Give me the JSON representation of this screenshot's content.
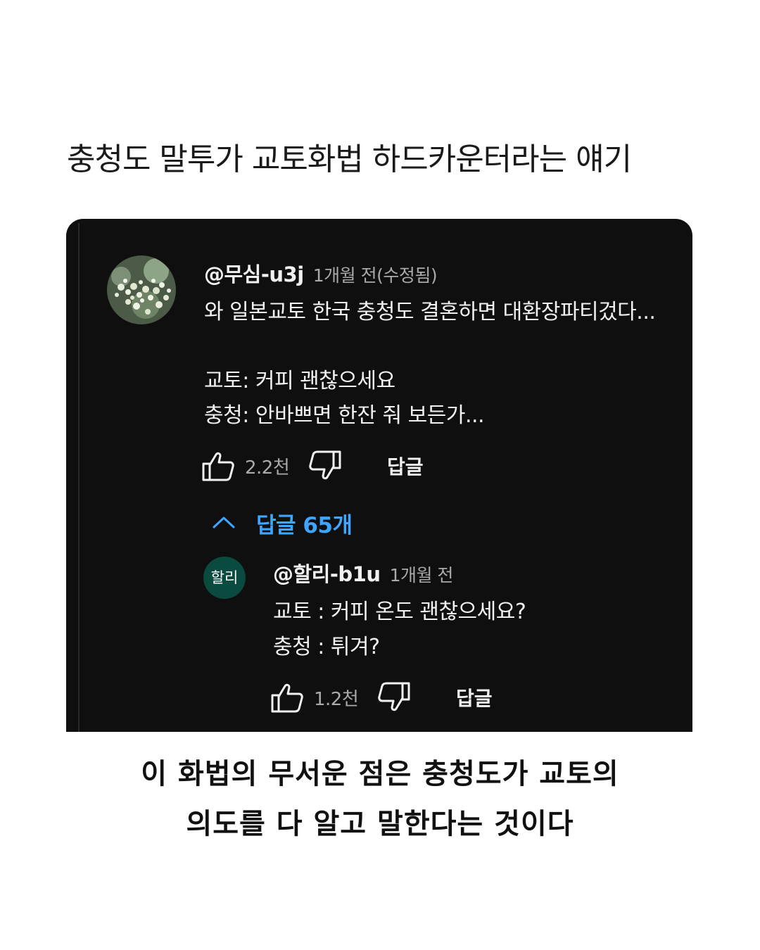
{
  "page_title": "충청도 말투가 교토화법 하드카운터라는 얘기",
  "comment": {
    "author": "@무심-u3j",
    "time": "1개월 전(수정됨)",
    "lines": [
      "와 일본교토 한국 충청도 결혼하면 대환장파티겄다...",
      "",
      "교토: 커피 괜찮으세요",
      "충청: 안바쁘면 한잔 줘 보든가..."
    ],
    "likes": "2.2천",
    "reply_label": "답글",
    "replies_toggle": "답글 65개",
    "accent_color": "#3ea6ff"
  },
  "reply": {
    "avatar_text": "할리",
    "avatar_color": "#0b4a3e",
    "author": "@할리-b1u",
    "time": "1개월 전",
    "lines": [
      "교토 : 커피 온도 괜찮으세요?",
      "충청 : 튀겨?"
    ],
    "likes": "1.2천",
    "reply_label": "답글"
  },
  "caption": {
    "line1": "이 화법의 무서운 점은 충청도가 교토의",
    "line2": "의도를 다 알고 말한다는 것이다"
  }
}
